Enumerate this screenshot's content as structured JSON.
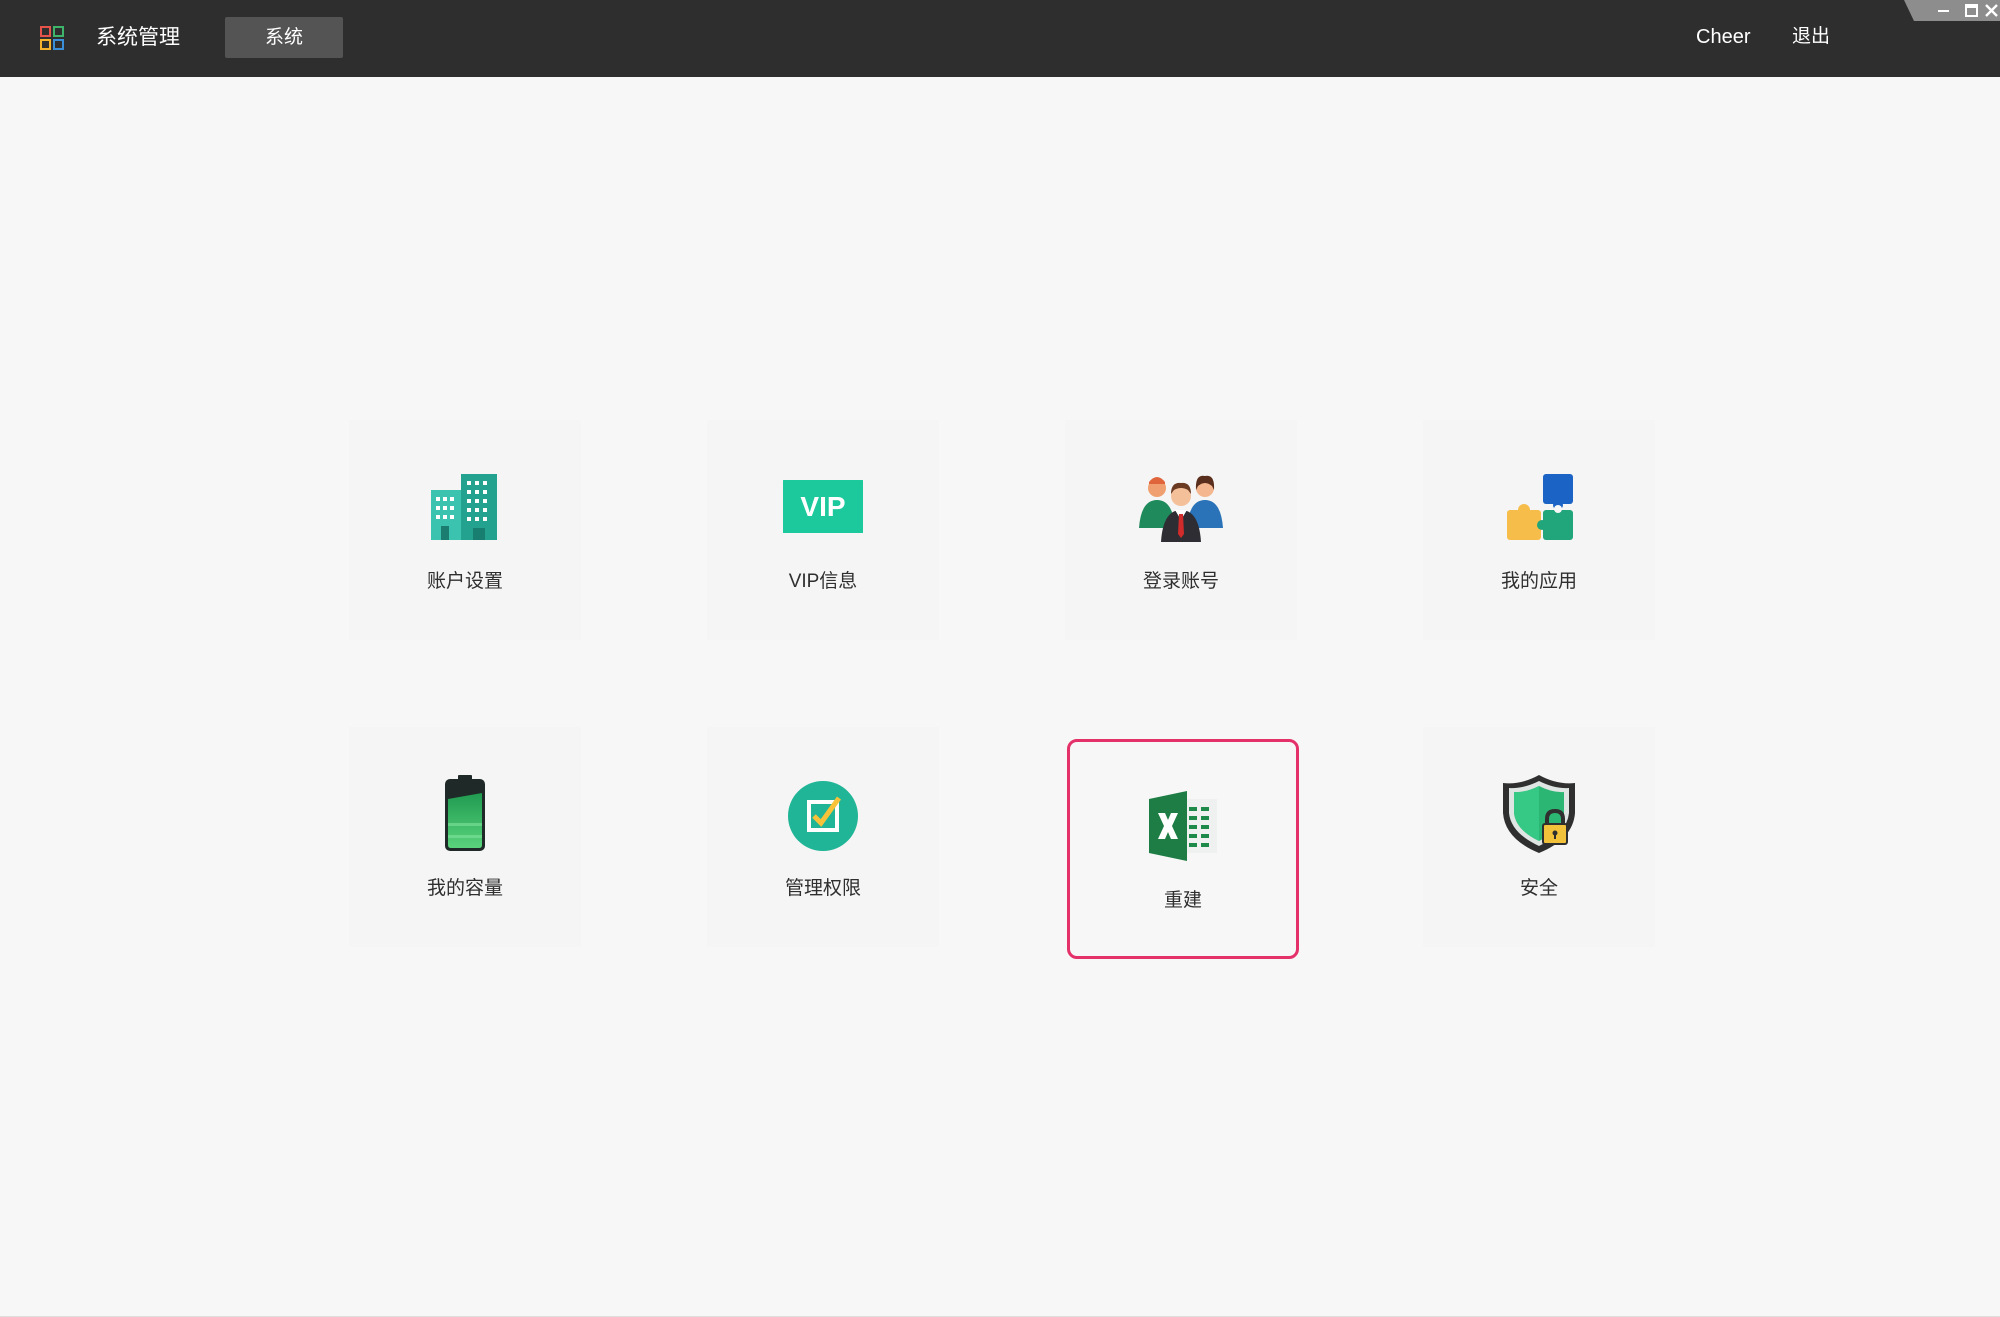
{
  "topbar": {
    "app_title": "系统管理",
    "tab_label": "系统",
    "user_name": "Cheer",
    "logout_label": "退出",
    "logo_icon": "app-grid-icon",
    "colors": {
      "background": "#2e2e2e",
      "tab_active": "#545454"
    }
  },
  "window_controls": [
    "minimize-icon",
    "maximize-icon",
    "close-icon"
  ],
  "tiles": [
    {
      "label": "账户设置",
      "icon": "building-icon"
    },
    {
      "label": "VIP信息",
      "icon": "vip-icon",
      "icon_text": "VIP"
    },
    {
      "label": "登录账号",
      "icon": "people-icon"
    },
    {
      "label": "我的应用",
      "icon": "puzzle-icon"
    },
    {
      "label": "我的容量",
      "icon": "battery-icon"
    },
    {
      "label": "管理权限",
      "icon": "checkbox-icon"
    },
    {
      "label": "重建",
      "icon": "excel-icon",
      "highlighted": true
    },
    {
      "label": "安全",
      "icon": "shield-lock-icon"
    }
  ],
  "colors": {
    "page_background": "#f7f7f7",
    "highlight_border": "#e4316a",
    "label_text": "#2f2f2f"
  }
}
